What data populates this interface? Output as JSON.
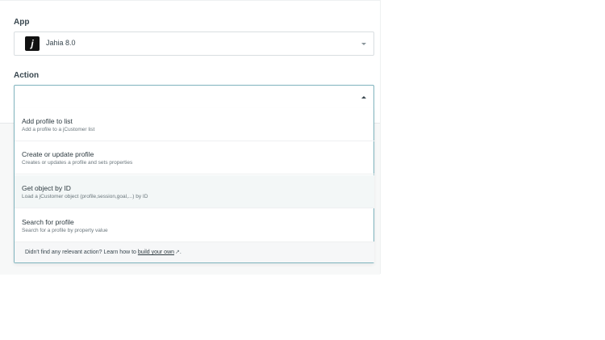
{
  "app_field": {
    "label": "App",
    "logo_letter": "j",
    "selected_value": "Jahia 8.0"
  },
  "action_field": {
    "label": "Action",
    "value": ""
  },
  "options": [
    {
      "title": "Add profile to list",
      "description": "Add a profile to a jCustomer list"
    },
    {
      "title": "Create or update profile",
      "description": "Creates or updates a profile and sets properties"
    },
    {
      "title": "Get object by ID",
      "description": "Load a jCustomer object (profile,session,goal,...) by ID"
    },
    {
      "title": "Search for profile",
      "description": "Search for a profile by property value"
    }
  ],
  "footer": {
    "prefix": "Didn't find any relevant action? Learn how to ",
    "link_text": "build your own",
    "suffix": "."
  },
  "colors": {
    "accent_border": "#7fb3bd",
    "hover_row": "#f3f7f7"
  }
}
